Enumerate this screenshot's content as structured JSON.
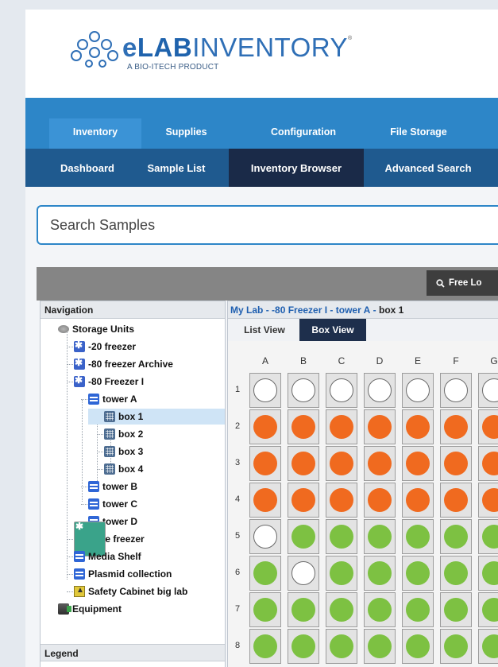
{
  "logo": {
    "brand_e": "e",
    "brand_lab": "LAB",
    "brand_inv": "INVENTORY",
    "reg": "®",
    "tagline": "A BIO-ITECH PRODUCT"
  },
  "main_nav": [
    "Inventory",
    "Supplies",
    "Configuration",
    "File Storage"
  ],
  "sub_nav": [
    "Dashboard",
    "Sample List",
    "Inventory Browser",
    "Advanced Search"
  ],
  "search": {
    "placeholder": "Search Samples"
  },
  "toolbar": {
    "free_label": "Free Lo",
    "free_icon": "search-icon"
  },
  "navigation": {
    "title": "Navigation",
    "legend_title": "Legend",
    "items": [
      {
        "label": "Storage Units",
        "icon": "storage-icon",
        "level": 0
      },
      {
        "label": "-20 freezer",
        "icon": "freezer-icon",
        "level": 1
      },
      {
        "label": "-80 freezer Archive",
        "icon": "freezer-icon",
        "level": 1
      },
      {
        "label": "-80 Freezer I",
        "icon": "freezer-icon",
        "level": 1
      },
      {
        "label": "tower A",
        "icon": "shelf-icon",
        "level": 2
      },
      {
        "label": "box 1",
        "icon": "box-icon",
        "level": 3,
        "selected": true
      },
      {
        "label": "box 2",
        "icon": "box-icon",
        "level": 3
      },
      {
        "label": "box 3",
        "icon": "box-icon",
        "level": 3
      },
      {
        "label": "box 4",
        "icon": "box-icon",
        "level": 3
      },
      {
        "label": "tower B",
        "icon": "shelf-icon",
        "level": 2
      },
      {
        "label": "tower C",
        "icon": "shelf-icon",
        "level": 2
      },
      {
        "label": "tower D",
        "icon": "shelf-icon",
        "level": 2
      },
      {
        "label": "Cell line freezer",
        "icon": "cell-freezer-icon",
        "level": 1
      },
      {
        "label": "Media Shelf",
        "icon": "shelf-icon",
        "level": 1
      },
      {
        "label": "Plasmid collection",
        "icon": "shelf-icon",
        "level": 1
      },
      {
        "label": "Safety Cabinet big lab",
        "icon": "safety-icon",
        "level": 1
      },
      {
        "label": "Equipment",
        "icon": "equipment-icon",
        "level": 0
      }
    ]
  },
  "breadcrumb": {
    "items": [
      "My Lab",
      "-80 Freezer I",
      "tower A"
    ],
    "current": "box 1",
    "separator": "-"
  },
  "view_tabs": [
    "List View",
    "Box View"
  ],
  "box": {
    "columns": [
      "A",
      "B",
      "C",
      "D",
      "E",
      "F",
      "G"
    ],
    "rows": [
      "1",
      "2",
      "3",
      "4",
      "5",
      "6",
      "7",
      "8"
    ],
    "colors": {
      "empty": "#ffffff",
      "orange": "#f06a1f",
      "green": "#7dc142"
    },
    "wells": [
      [
        "empty",
        "empty",
        "empty",
        "empty",
        "empty",
        "empty",
        "empty"
      ],
      [
        "orange",
        "orange",
        "orange",
        "orange",
        "orange",
        "orange",
        "orange"
      ],
      [
        "orange",
        "orange",
        "orange",
        "orange",
        "orange",
        "orange",
        "orange"
      ],
      [
        "orange",
        "orange",
        "orange",
        "orange",
        "orange",
        "orange",
        "orange"
      ],
      [
        "empty",
        "green",
        "green",
        "green",
        "green",
        "green",
        "green"
      ],
      [
        "green",
        "empty",
        "green",
        "green",
        "green",
        "green",
        "green"
      ],
      [
        "green",
        "green",
        "green",
        "green",
        "green",
        "green",
        "green"
      ],
      [
        "green",
        "green",
        "green",
        "green",
        "green",
        "green",
        "green"
      ]
    ]
  }
}
